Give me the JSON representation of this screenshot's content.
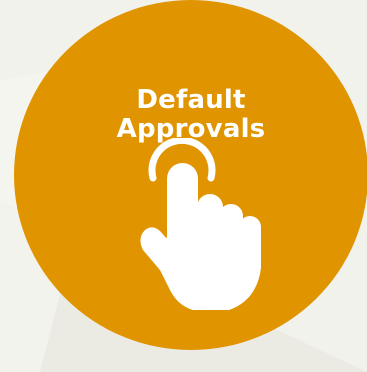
{
  "tile": {
    "title_line1": "Default",
    "title_line2": "Approvals",
    "icon": "tap-hand-icon",
    "colors": {
      "circle": "#e09400",
      "text": "#ffffff",
      "background": "#f2f2ec"
    }
  }
}
